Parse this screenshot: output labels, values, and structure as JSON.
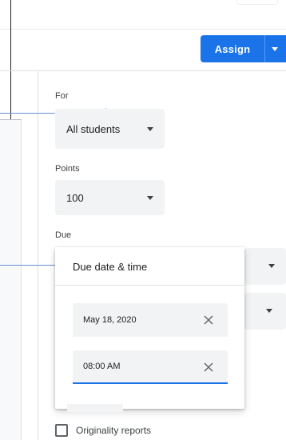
{
  "header": {
    "assign_label": "Assign"
  },
  "form": {
    "for_label": "For",
    "for_value": "All students",
    "points_label": "Points",
    "points_value": "100",
    "due_label": "Due"
  },
  "due_popup": {
    "title": "Due date & time",
    "date_value": "May 18, 2020",
    "time_value": "08:00 AM"
  },
  "options": {
    "originality_label": "Originality reports"
  },
  "colors": {
    "accent": "#1a73e8",
    "arrow": "#6b8fd6"
  },
  "icons": {
    "clear": "close-icon",
    "dropdown": "arrow-drop-down-icon"
  }
}
